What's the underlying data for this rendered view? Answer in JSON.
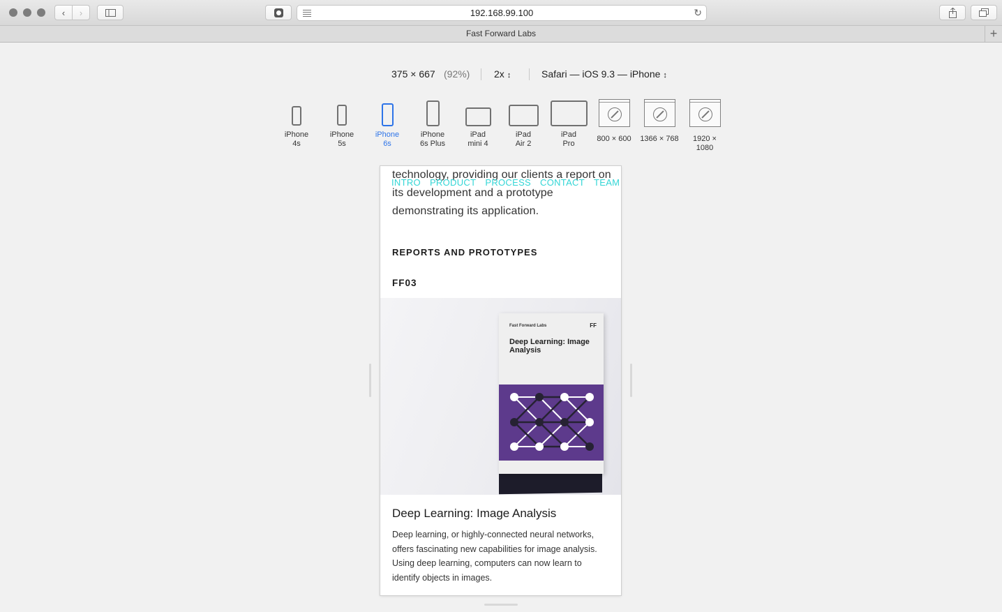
{
  "browser": {
    "url": "192.168.99.100",
    "tab_title": "Fast Forward Labs"
  },
  "rdm": {
    "dimensions": "375 × 667",
    "zoom": "(92%)",
    "pixel_ratio": "2x",
    "user_agent": "Safari — iOS 9.3 — iPhone",
    "devices": [
      {
        "line1": "iPhone",
        "line2": "4s"
      },
      {
        "line1": "iPhone",
        "line2": "5s"
      },
      {
        "line1": "iPhone",
        "line2": "6s",
        "active": true
      },
      {
        "line1": "iPhone",
        "line2": "6s Plus"
      },
      {
        "line1": "iPad",
        "line2": "mini 4"
      },
      {
        "line1": "iPad",
        "line2": "Air 2"
      },
      {
        "line1": "iPad",
        "line2": "Pro"
      },
      {
        "line1": "800 × 600"
      },
      {
        "line1": "1366 × 768"
      },
      {
        "line1": "1920 × 1080"
      }
    ],
    "accent_color": "#2d74e8"
  },
  "page": {
    "intro_text": "technology, providing our clients a report on its development and a prototype demonstrating its application.",
    "nav": [
      "INTRO",
      "PRODUCT",
      "PROCESS",
      "CONTACT",
      "TEAM"
    ],
    "nav_color": "#33d6d6",
    "section_heading": "REPORTS AND PROTOTYPES",
    "report_code": "FF03",
    "book": {
      "publisher": "Fast Forward Labs",
      "logo": "FF",
      "title": "Deep Learning: Image Analysis",
      "cover_color": "#5d3a8c"
    },
    "card_title": "Deep Learning: Image Analysis",
    "card_description": "Deep learning, or highly-connected neural networks, offers fascinating new capabilities for image analysis. Using deep learning, computers can now learn to identify objects in images."
  }
}
